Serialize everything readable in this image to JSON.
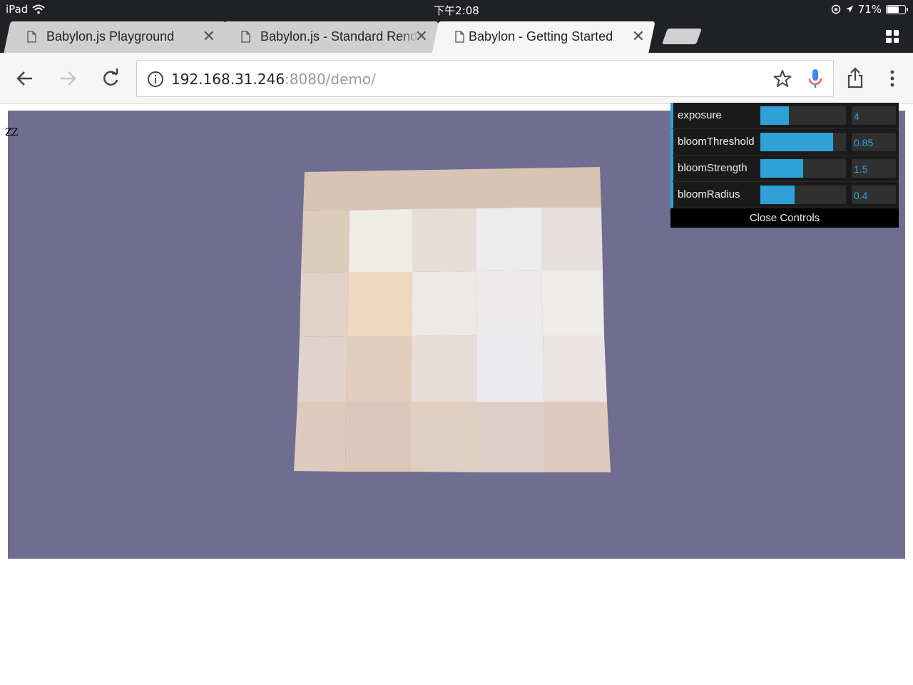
{
  "status_bar": {
    "device": "iPad",
    "time": "下午2:08",
    "battery_text": "71%",
    "battery_level": 0.71
  },
  "tabs": [
    {
      "title": "Babylon.js Playground",
      "active": false
    },
    {
      "title": "Babylon.js - Standard Render",
      "active": false
    },
    {
      "title": "Babylon - Getting Started",
      "active": true
    }
  ],
  "address_bar": {
    "url_host": "192.168.31.246",
    "url_rest": ":8080/demo/"
  },
  "canvas": {
    "background": "#6f6d90",
    "debug_text": "ZZ"
  },
  "controls": {
    "items": [
      {
        "label": "exposure",
        "value": "4",
        "fill": 0.33
      },
      {
        "label": "bloomThreshold",
        "value": "0.85",
        "fill": 0.85
      },
      {
        "label": "bloomStrength",
        "value": "1.5",
        "fill": 0.5
      },
      {
        "label": "bloomRadius",
        "value": "0.4",
        "fill": 0.4
      }
    ],
    "close_label": "Close Controls",
    "accent": "#2fa1d6"
  },
  "icons": {
    "back": "arrow-left-icon",
    "forward": "arrow-right-icon",
    "reload": "reload-icon",
    "info": "info-icon",
    "bookmark": "star-icon",
    "voice": "microphone-icon",
    "share": "share-icon",
    "menu": "more-vertical-icon",
    "tab_switcher": "grid-icon"
  }
}
